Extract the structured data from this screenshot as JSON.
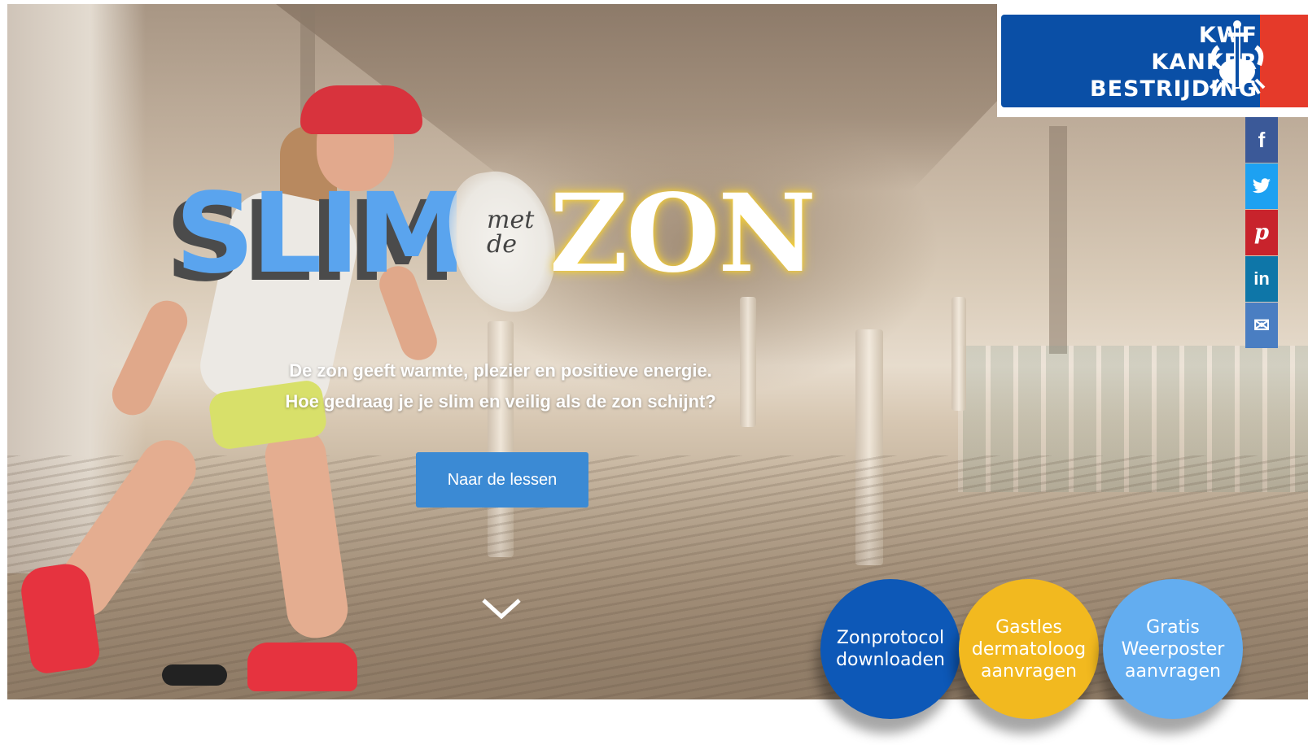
{
  "hero": {
    "title_slim": "SLIM",
    "title_met": "met",
    "title_de": "de",
    "title_zon": "ZON",
    "subtitle_line1": "De zon geeft warmte, plezier en positieve energie.",
    "subtitle_line2": "Hoe gedraag je je slim en veilig als de zon schijnt?",
    "cta_label": "Naar de lessen",
    "scroll_icon": "chevron-down-icon"
  },
  "logo": {
    "line1": "KWF",
    "line2": "KANKER",
    "line3": "BESTRIJDING",
    "emblem_icon": "crab-sword-emblem",
    "colors": {
      "blue": "#0a4fa6",
      "red": "#e53a2a"
    }
  },
  "share": [
    {
      "icon": "facebook-icon",
      "glyph": "f",
      "color": "#3b5998"
    },
    {
      "icon": "twitter-icon",
      "glyph": "🐦",
      "color": "#1da1f2"
    },
    {
      "icon": "pinterest-icon",
      "glyph": "p",
      "color": "#c8232c"
    },
    {
      "icon": "linkedin-icon",
      "glyph": "in",
      "color": "#0e76a8"
    },
    {
      "icon": "email-icon",
      "glyph": "✉",
      "color": "#4a7ec2"
    }
  ],
  "actions": [
    {
      "line1": "Zonprotocol",
      "line2": "downloaden",
      "line3": "",
      "color": "#0d58b7"
    },
    {
      "line1": "Gastles",
      "line2": "dermatoloog",
      "line3": "aanvragen",
      "color": "#f2b91f"
    },
    {
      "line1": "Gratis",
      "line2": "Weerposter",
      "line3": "aanvragen",
      "color": "#63adf0"
    }
  ]
}
